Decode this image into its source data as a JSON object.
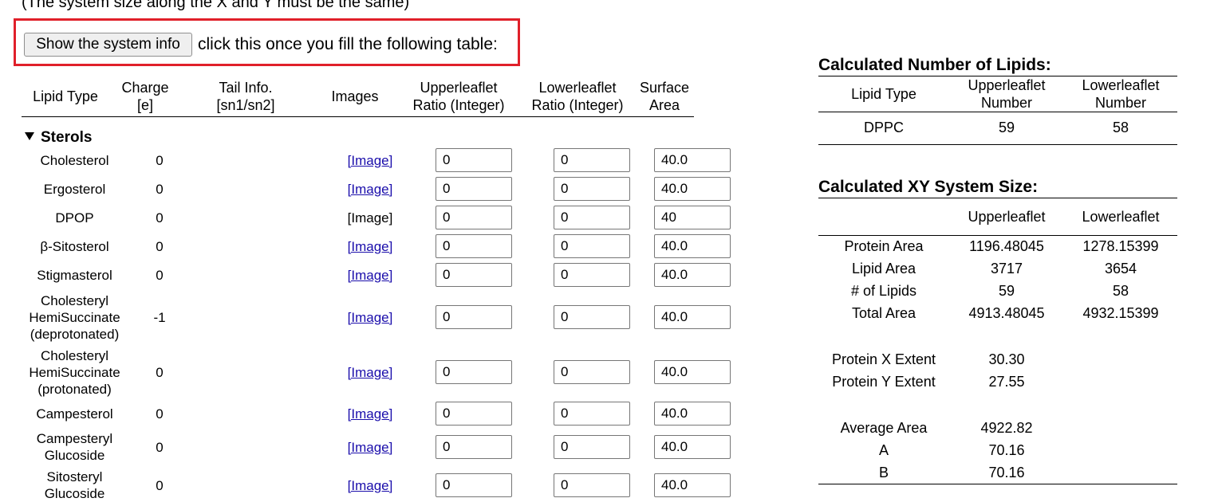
{
  "top_note": "(The system size along the X and Y must be the same)",
  "system_info": {
    "button_label": "Show the system info",
    "instruction": "click this once you fill the following table:"
  },
  "lipid_table": {
    "headers": {
      "lipid_type": "Lipid Type",
      "charge": [
        "Charge",
        "[e]"
      ],
      "tail_info": [
        "Tail Info.",
        "[sn1/sn2]"
      ],
      "images": "Images",
      "upper": [
        "Upperleaflet",
        "Ratio (Integer)"
      ],
      "lower": [
        "Lowerleaflet",
        "Ratio (Integer)"
      ],
      "surface": [
        "Surface",
        "Area"
      ]
    },
    "section": "Sterols",
    "rows": [
      {
        "name": [
          "Cholesterol"
        ],
        "charge": "0",
        "image": "[Image]",
        "image_link": true,
        "upper": "0",
        "lower": "0",
        "area": "40.0"
      },
      {
        "name": [
          "Ergosterol"
        ],
        "charge": "0",
        "image": "[Image]",
        "image_link": true,
        "upper": "0",
        "lower": "0",
        "area": "40.0"
      },
      {
        "name": [
          "DPOP"
        ],
        "charge": "0",
        "image": "[Image]",
        "image_link": false,
        "upper": "0",
        "lower": "0",
        "area": "40"
      },
      {
        "name": [
          "β-Sitosterol"
        ],
        "charge": "0",
        "image": "[Image]",
        "image_link": true,
        "upper": "0",
        "lower": "0",
        "area": "40.0"
      },
      {
        "name": [
          "Stigmasterol"
        ],
        "charge": "0",
        "image": "[Image]",
        "image_link": true,
        "upper": "0",
        "lower": "0",
        "area": "40.0"
      },
      {
        "name": [
          "Cholesteryl",
          "HemiSuccinate",
          "(deprotonated)"
        ],
        "charge": "-1",
        "image": "[Image]",
        "image_link": true,
        "upper": "0",
        "lower": "0",
        "area": "40.0"
      },
      {
        "name": [
          "Cholesteryl",
          "HemiSuccinate",
          "(protonated)"
        ],
        "charge": "0",
        "image": "[Image]",
        "image_link": true,
        "upper": "0",
        "lower": "0",
        "area": "40.0"
      },
      {
        "name": [
          "Campesterol"
        ],
        "charge": "0",
        "image": "[Image]",
        "image_link": true,
        "upper": "0",
        "lower": "0",
        "area": "40.0"
      },
      {
        "name": [
          "Campesteryl",
          "Glucoside"
        ],
        "charge": "0",
        "image": "[Image]",
        "image_link": true,
        "upper": "0",
        "lower": "0",
        "area": "40.0"
      },
      {
        "name": [
          "Sitosteryl",
          "Glucoside"
        ],
        "charge": "0",
        "image": "[Image]",
        "image_link": true,
        "upper": "0",
        "lower": "0",
        "area": "40.0"
      }
    ]
  },
  "calc_lipids": {
    "title": "Calculated Number of Lipids:",
    "headers": [
      "Lipid Type",
      [
        "Upperleaflet",
        "Number"
      ],
      [
        "Lowerleaflet",
        "Number"
      ]
    ],
    "row": {
      "type": "DPPC",
      "upper": "59",
      "lower": "58"
    }
  },
  "calc_size": {
    "title": "Calculated XY System Size:",
    "headers": [
      "",
      "Upperleaflet",
      "Lowerleaflet"
    ],
    "area_rows": [
      {
        "label": "Protein Area",
        "upper": "1196.48045",
        "lower": "1278.15399"
      },
      {
        "label": "Lipid Area",
        "upper": "3717",
        "lower": "3654"
      },
      {
        "label": "# of Lipids",
        "upper": "59",
        "lower": "58"
      },
      {
        "label": "Total Area",
        "upper": "4913.48045",
        "lower": "4932.15399"
      }
    ],
    "extent_rows": [
      {
        "label": "Protein X Extent",
        "value": "30.30"
      },
      {
        "label": "Protein Y Extent",
        "value": "27.55"
      }
    ],
    "avg_rows": [
      {
        "label": "Average Area",
        "value": "4922.82"
      },
      {
        "label": "A",
        "value": "70.16"
      },
      {
        "label": "B",
        "value": "70.16"
      }
    ]
  }
}
